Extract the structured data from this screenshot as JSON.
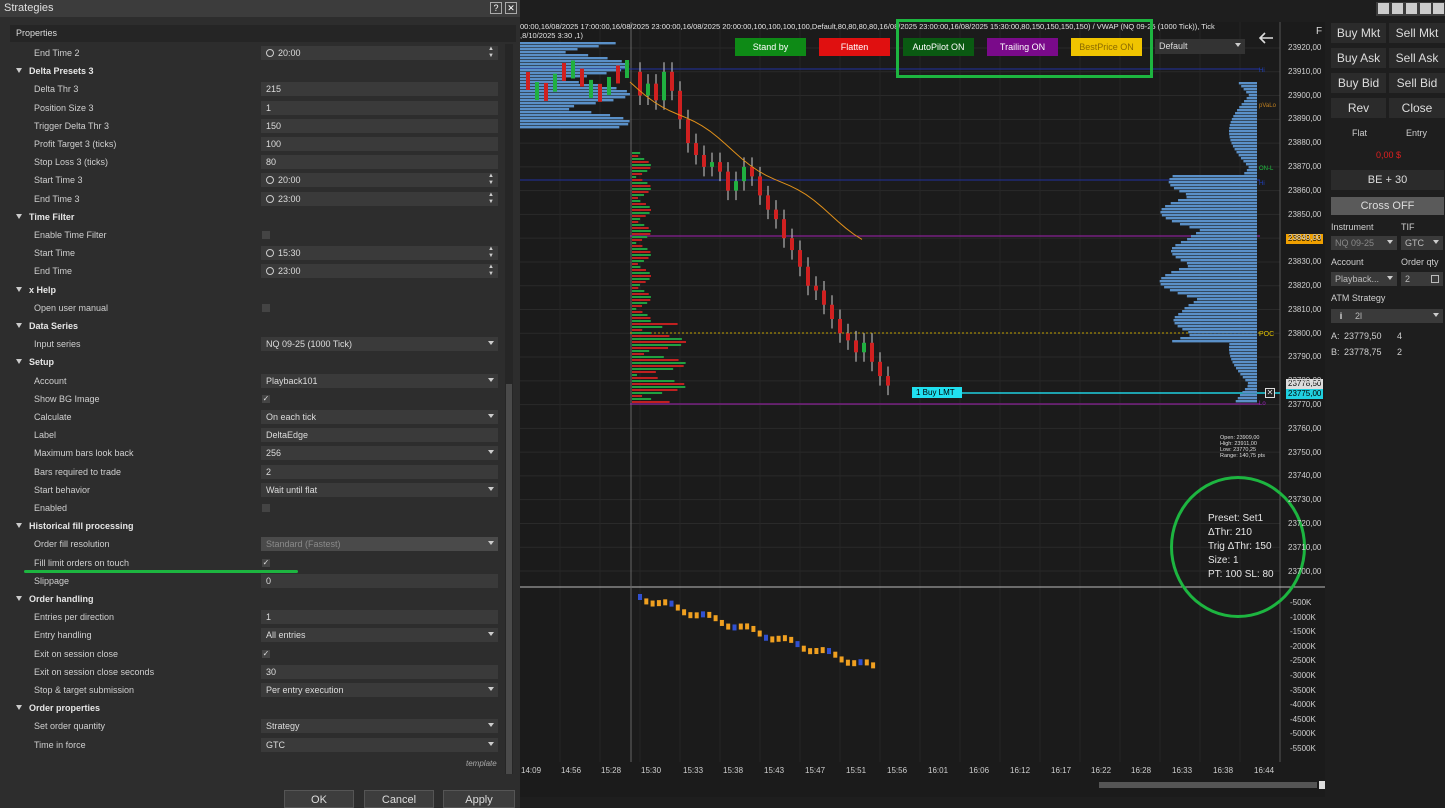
{
  "window": {
    "title": "Strategies",
    "help": "?",
    "close": "✕"
  },
  "properties": {
    "header": "Properties",
    "rows": [
      {
        "kind": "prop",
        "label": "End Time 2",
        "type": "time",
        "value": "20:00"
      },
      {
        "kind": "cat",
        "label": "Delta Presets 3"
      },
      {
        "kind": "prop",
        "label": "Delta Thr 3",
        "type": "text",
        "value": "215"
      },
      {
        "kind": "prop",
        "label": "Position Size 3",
        "type": "text",
        "value": "1"
      },
      {
        "kind": "prop",
        "label": "Trigger Delta Thr 3",
        "type": "text",
        "value": "150"
      },
      {
        "kind": "prop",
        "label": "Profit Target 3 (ticks)",
        "type": "text",
        "value": "100"
      },
      {
        "kind": "prop",
        "label": "Stop Loss 3 (ticks)",
        "type": "text",
        "value": "80"
      },
      {
        "kind": "prop",
        "label": "Start Time 3",
        "type": "time",
        "value": "20:00"
      },
      {
        "kind": "prop",
        "label": "End Time 3",
        "type": "time",
        "value": "23:00"
      },
      {
        "kind": "cat",
        "label": "Time Filter"
      },
      {
        "kind": "prop",
        "label": "Enable Time Filter",
        "type": "check",
        "value": ""
      },
      {
        "kind": "prop",
        "label": "Start Time",
        "type": "time",
        "value": "15:30"
      },
      {
        "kind": "prop",
        "label": "End Time",
        "type": "time",
        "value": "23:00"
      },
      {
        "kind": "cat",
        "label": "x Help"
      },
      {
        "kind": "prop",
        "label": "Open user manual",
        "type": "check",
        "value": ""
      },
      {
        "kind": "cat",
        "label": "Data Series"
      },
      {
        "kind": "prop",
        "label": "Input series",
        "type": "select",
        "value": "NQ 09-25 (1000 Tick)"
      },
      {
        "kind": "cat",
        "label": "Setup"
      },
      {
        "kind": "prop",
        "label": "Account",
        "type": "select",
        "value": "Playback101"
      },
      {
        "kind": "prop",
        "label": "Show BG Image",
        "type": "check",
        "value": "✓"
      },
      {
        "kind": "prop",
        "label": "Calculate",
        "type": "select",
        "value": "On each tick"
      },
      {
        "kind": "prop",
        "label": "Label",
        "type": "text",
        "value": "DeltaEdge"
      },
      {
        "kind": "prop",
        "label": "Maximum bars look back",
        "type": "select",
        "value": "256"
      },
      {
        "kind": "prop",
        "label": "Bars required to trade",
        "type": "text",
        "value": "2"
      },
      {
        "kind": "prop",
        "label": "Start behavior",
        "type": "select",
        "value": "Wait until flat"
      },
      {
        "kind": "prop",
        "label": "Enabled",
        "type": "check",
        "value": ""
      },
      {
        "kind": "cat",
        "label": "Historical fill processing"
      },
      {
        "kind": "prop",
        "label": "Order fill resolution",
        "type": "select-dis",
        "value": "Standard (Fastest)"
      },
      {
        "kind": "prop",
        "label": "Fill limit orders on touch",
        "type": "check",
        "value": "✓"
      },
      {
        "kind": "prop",
        "label": "Slippage",
        "type": "text",
        "value": "0"
      },
      {
        "kind": "cat",
        "label": "Order handling"
      },
      {
        "kind": "prop",
        "label": "Entries per direction",
        "type": "text",
        "value": "1"
      },
      {
        "kind": "prop",
        "label": "Entry handling",
        "type": "select",
        "value": "All entries"
      },
      {
        "kind": "prop",
        "label": "Exit on session close",
        "type": "check",
        "value": "✓"
      },
      {
        "kind": "prop",
        "label": "Exit on session close seconds",
        "type": "text",
        "value": "30"
      },
      {
        "kind": "prop",
        "label": "Stop & target submission",
        "type": "select",
        "value": "Per entry execution"
      },
      {
        "kind": "cat",
        "label": "Order properties"
      },
      {
        "kind": "prop",
        "label": "Set order quantity",
        "type": "select",
        "value": "Strategy"
      },
      {
        "kind": "prop",
        "label": "Time in force",
        "type": "select",
        "value": "GTC"
      }
    ],
    "template": "template"
  },
  "dialog_buttons": {
    "ok": "OK",
    "cancel": "Cancel",
    "apply": "Apply"
  },
  "chart": {
    "info_line1": "00:00,16/08/2025 17:00:00,16/08/2025 23:00:00,16/08/2025 20:00:00,100,100,100,100,Default,80,80,80,80,16/08/2025 23:00:00,16/08/2025 15:30:00,80,150,150,150,150) / VWAP (NQ 09-25 (1000 Tick)), Tick",
    "info_line2": ",8/10/2025 3:30 ,1)",
    "f_label": "F",
    "buttons": [
      {
        "label": "Stand by",
        "bg": "#0e8a16",
        "fg": "#ffffff"
      },
      {
        "label": "Flatten",
        "bg": "#e01010",
        "fg": "#ffffff"
      },
      {
        "label": "AutoPilot ON",
        "bg": "#0a5a12",
        "fg": "#ffffff"
      },
      {
        "label": "Trailing ON",
        "bg": "#7a0a8a",
        "fg": "#ffffff"
      },
      {
        "label": "BestPrice ON",
        "bg": "#f0c400",
        "fg": "#8a6a00"
      }
    ],
    "preset_select": "Default",
    "back_arrow": "arrow-left-icon",
    "price_axis": [
      "23920,00",
      "23910,00",
      "23900,00",
      "23890,00",
      "23880,00",
      "23870,00",
      "23860,00",
      "23850,00",
      "23840,00",
      "23830,00",
      "23820,00",
      "23810,00",
      "23800,00",
      "23790,00",
      "23780,00",
      "23770,00",
      "23760,00",
      "23750,00",
      "23740,00",
      "23730,00",
      "23720,00",
      "23710,00",
      "23700,00"
    ],
    "delta_axis": [
      "-500K",
      "-1000K",
      "-1500K",
      "-2000K",
      "-2500K",
      "-3000K",
      "-3500K",
      "-4000K",
      "-4500K",
      "-5000K",
      "-5500K"
    ],
    "time_axis": [
      "14:09",
      "14:56",
      "15:28",
      "15:30",
      "15:33",
      "15:38",
      "15:43",
      "15:47",
      "15:51",
      "15:56",
      "16:01",
      "16:06",
      "16:12",
      "16:17",
      "16:22",
      "16:28",
      "16:33",
      "16:38",
      "16:44"
    ],
    "price_tags": {
      "purple": "23839,93",
      "last": "23778,50",
      "limit": "23775,00"
    },
    "line_labels": [
      "Hi",
      "pVaLo",
      "POC",
      "ON-L",
      "Hi",
      "Lo"
    ],
    "order_label": "1  Buy LMT",
    "ohlc": [
      "Open: 23909,00",
      "High: 23911,00",
      "Low: 23770,25",
      "Range: 140,75 pts"
    ],
    "preset_panel": [
      "Preset: Set1",
      "ΔThr: 210",
      "Trig ΔThr: 150",
      "Size: 1",
      "PT: 100   SL: 80"
    ]
  },
  "chart_trader": {
    "buttons": [
      [
        "Buy Mkt",
        "Sell Mkt"
      ],
      [
        "Buy Ask",
        "Sell Ask"
      ],
      [
        "Buy Bid",
        "Sell Bid"
      ],
      [
        "Rev",
        "Close"
      ]
    ],
    "flat": "Flat",
    "entry": "Entry",
    "pnl": "0,00 $",
    "be": "BE + 30",
    "cross": "Cross OFF",
    "instrument_label": "Instrument",
    "tif_label": "TIF",
    "instrument": "NQ 09-25",
    "tif": "GTC",
    "account_label": "Account",
    "qty_label": "Order qty",
    "account": "Playback...",
    "qty": "2",
    "atm_label": "ATM Strategy",
    "atm": "2l",
    "ask_label": "A:",
    "ask": "23779,50",
    "ask_size": "4",
    "bid_label": "B:",
    "bid": "23778,75",
    "bid_size": "2"
  }
}
